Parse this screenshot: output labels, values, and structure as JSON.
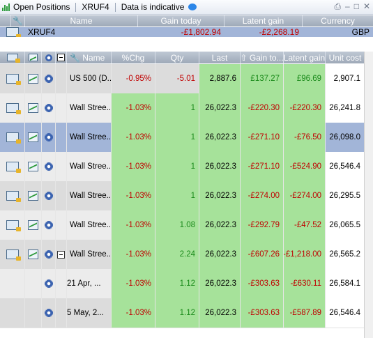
{
  "window": {
    "title": "Open Positions",
    "account": "XRUF4",
    "notice": "Data is indicative",
    "icons": [
      "bar-chart-icon",
      "speech-bubble-icon",
      "print-icon",
      "minimize-icon",
      "maximize-icon",
      "close-icon"
    ]
  },
  "summary_header": {
    "name": "Name",
    "gain_today": "Gain today",
    "latent_gain": "Latent gain",
    "currency": "Currency"
  },
  "summary_row": {
    "name": "XRUF4",
    "gain_today": "-£1,802.94",
    "latent_gain": "-£2,268.19",
    "currency": "GBP"
  },
  "grid_header": {
    "name": "Name",
    "chg": "%Chg",
    "qty": "Qty",
    "last": "Last",
    "gain_today": "Gain to...",
    "latent_gain": "Latent gain",
    "unit_cost": "Unit cost"
  },
  "rows": [
    {
      "name": "US 500 (D...",
      "chg": "-0.95%",
      "qty": "-5.01",
      "last": "2,887.6",
      "gain_today": "£137.27",
      "latent_gain": "£96.69",
      "unit_cost": "2,907.1"
    },
    {
      "name": "Wall Stree...",
      "chg": "-1.03%",
      "qty": "1",
      "last": "26,022.3",
      "gain_today": "-£220.30",
      "latent_gain": "-£220.30",
      "unit_cost": "26,241.8"
    },
    {
      "name": "Wall Stree...",
      "chg": "-1.03%",
      "qty": "1",
      "last": "26,022.3",
      "gain_today": "-£271.10",
      "latent_gain": "-£76.50",
      "unit_cost": "26,098.0"
    },
    {
      "name": "Wall Stree...",
      "chg": "-1.03%",
      "qty": "1",
      "last": "26,022.3",
      "gain_today": "-£271.10",
      "latent_gain": "-£524.90",
      "unit_cost": "26,546.4"
    },
    {
      "name": "Wall Stree...",
      "chg": "-1.03%",
      "qty": "1",
      "last": "26,022.3",
      "gain_today": "-£274.00",
      "latent_gain": "-£274.00",
      "unit_cost": "26,295.5"
    },
    {
      "name": "Wall Stree...",
      "chg": "-1.03%",
      "qty": "1.08",
      "last": "26,022.3",
      "gain_today": "-£292.79",
      "latent_gain": "-£47.52",
      "unit_cost": "26,065.5"
    },
    {
      "name": "Wall Stree...",
      "chg": "-1.03%",
      "qty": "2.24",
      "last": "26,022.3",
      "gain_today": "-£607.26",
      "latent_gain": "-£1,218.00",
      "unit_cost": "26,565.2"
    },
    {
      "name": "21 Apr, ...",
      "chg": "-1.03%",
      "qty": "1.12",
      "last": "26,022.3",
      "gain_today": "-£303.63",
      "latent_gain": "-£630.11",
      "unit_cost": "26,584.1"
    },
    {
      "name": "5 May, 2...",
      "chg": "-1.03%",
      "qty": "1.12",
      "last": "26,022.3",
      "gain_today": "-£303.63",
      "latent_gain": "-£587.89",
      "unit_cost": "26,546.4"
    }
  ],
  "colors": {
    "header_bg": "#a9b3c2",
    "selected_row": "#a2b5d8",
    "positive_cell": "#a6e29a",
    "negative_text": "#c00000",
    "positive_text": "#1a8a1a"
  }
}
